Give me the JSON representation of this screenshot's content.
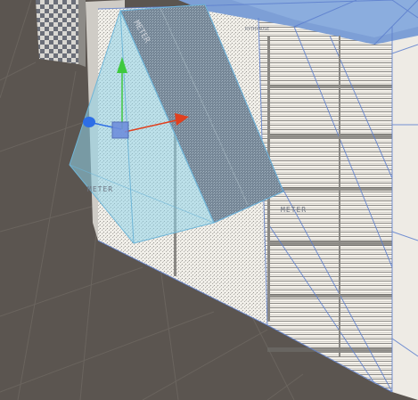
{
  "scene": {
    "texture_label_rotated": "METER",
    "texture_label_mid": "METER",
    "texture_label_left": "METER",
    "texture_label_small": "RYTHYAUSE"
  },
  "gizmo": {
    "y_axis_color": "#3ec93e",
    "x_axis_color": "#e0401f",
    "z_axis_color": "#2d6ee6",
    "center_color": "#6f8fdc"
  },
  "colors": {
    "background": "#5b5550",
    "grid": "#6a645e",
    "wall_light": "#f4f1ea",
    "wall_shadow": "#b5b4b0",
    "edge_blue": "#5d7fce",
    "frustum_fill": "#8fd4ea",
    "dark_panel": "#7f8591",
    "top_face": "#7d9fd6"
  }
}
